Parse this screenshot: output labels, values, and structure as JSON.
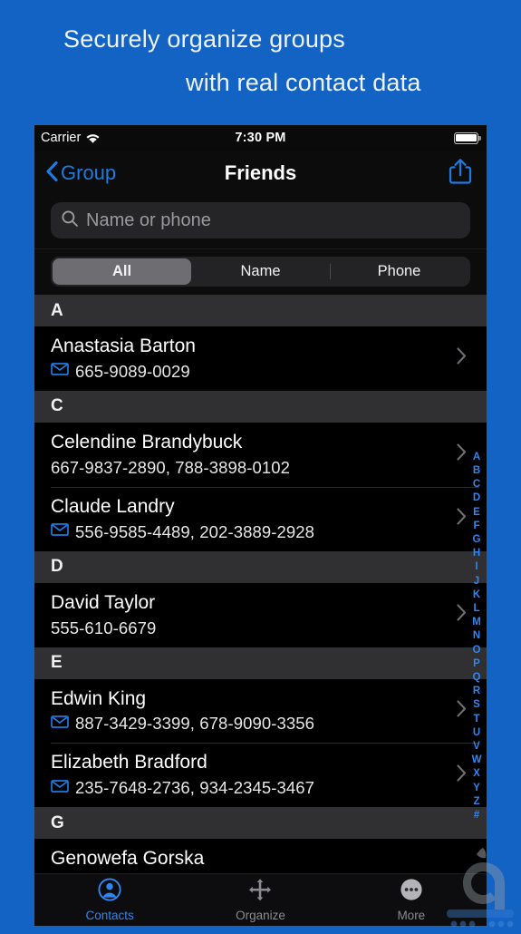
{
  "promo": {
    "line1": "Securely organize groups",
    "line2": "with real contact data"
  },
  "status_bar": {
    "carrier": "Carrier",
    "wifi_icon": "wifi-icon",
    "time": "7:30 PM",
    "battery_icon": "battery-full-icon"
  },
  "nav": {
    "back_icon": "chevron-left-icon",
    "back_label": "Group",
    "title": "Friends",
    "share_icon": "share-icon"
  },
  "search": {
    "icon": "search-icon",
    "placeholder": "Name or phone",
    "value": ""
  },
  "segmented": {
    "selected": "All",
    "options": [
      {
        "label": "All",
        "active": true
      },
      {
        "label": "Name",
        "active": false
      },
      {
        "label": "Phone",
        "active": false
      }
    ]
  },
  "list": [
    {
      "type": "header",
      "letter": "A"
    },
    {
      "type": "contact",
      "name": "Anastasia Barton",
      "has_mail_icon": true,
      "phones": "665-9089-0029"
    },
    {
      "type": "header",
      "letter": "C"
    },
    {
      "type": "contact",
      "name": "Celendine Brandybuck",
      "has_mail_icon": false,
      "phones": "667-9837-2890, 788-3898-0102"
    },
    {
      "type": "contact",
      "name": "Claude Landry",
      "has_mail_icon": true,
      "phones": "556-9585-4489, 202-3889-2928"
    },
    {
      "type": "header",
      "letter": "D"
    },
    {
      "type": "contact",
      "name": "David Taylor",
      "has_mail_icon": false,
      "phones": "555-610-6679"
    },
    {
      "type": "header",
      "letter": "E"
    },
    {
      "type": "contact",
      "name": "Edwin King",
      "has_mail_icon": true,
      "phones": "887-3429-3399, 678-9090-3356"
    },
    {
      "type": "contact",
      "name": "Elizabeth Bradford",
      "has_mail_icon": true,
      "phones": "235-7648-2736, 934-2345-3467"
    },
    {
      "type": "header",
      "letter": "G"
    },
    {
      "type": "contact",
      "name": "Genowefa Gorska",
      "has_mail_icon": true,
      "phones": ""
    }
  ],
  "index_bar": [
    "A",
    "B",
    "C",
    "D",
    "E",
    "F",
    "G",
    "H",
    "I",
    "J",
    "K",
    "L",
    "M",
    "N",
    "O",
    "P",
    "Q",
    "R",
    "S",
    "T",
    "U",
    "V",
    "W",
    "X",
    "Y",
    "Z",
    "#"
  ],
  "tabbar": [
    {
      "label": "Contacts",
      "icon": "person-circle-icon",
      "active": true
    },
    {
      "label": "Organize",
      "icon": "move-arrows-icon",
      "active": false
    },
    {
      "label": "More",
      "icon": "ellipsis-circle-icon",
      "active": false
    }
  ],
  "colors": {
    "accent_blue": "#2f86f0",
    "banner_blue": "#1263c4",
    "list_bg": "#000000",
    "section_header_bg": "#303032",
    "segment_active": "#6d6d72"
  }
}
